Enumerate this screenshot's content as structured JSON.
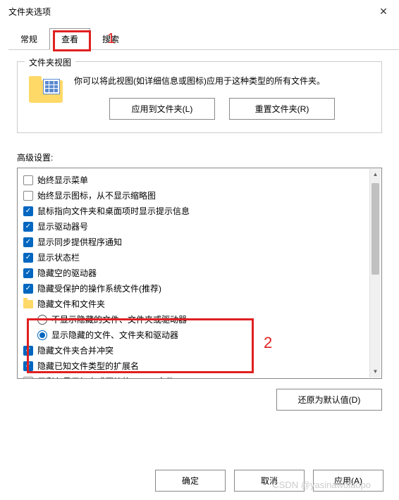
{
  "window": {
    "title": "文件夹选项"
  },
  "tabs": {
    "general": "常规",
    "view": "查看",
    "search": "搜索",
    "active": "view"
  },
  "folder_view": {
    "label": "文件夹视图",
    "text": "你可以将此视图(如详细信息或图标)应用于这种类型的所有文件夹。",
    "apply_button": "应用到文件夹(L)",
    "reset_button": "重置文件夹(R)"
  },
  "advanced": {
    "label": "高级设置:",
    "restore_defaults": "还原为默认值(D)",
    "items": [
      {
        "type": "checkbox",
        "checked": false,
        "label": "始终显示菜单"
      },
      {
        "type": "checkbox",
        "checked": false,
        "label": "始终显示图标，从不显示缩略图"
      },
      {
        "type": "checkbox",
        "checked": true,
        "label": "鼠标指向文件夹和桌面项时显示提示信息"
      },
      {
        "type": "checkbox",
        "checked": true,
        "label": "显示驱动器号"
      },
      {
        "type": "checkbox",
        "checked": true,
        "label": "显示同步提供程序通知"
      },
      {
        "type": "checkbox",
        "checked": true,
        "label": "显示状态栏"
      },
      {
        "type": "checkbox",
        "checked": true,
        "label": "隐藏空的驱动器"
      },
      {
        "type": "checkbox",
        "checked": true,
        "label": "隐藏受保护的操作系统文件(推荐)"
      },
      {
        "type": "group",
        "label": "隐藏文件和文件夹",
        "children": [
          {
            "type": "radio",
            "checked": false,
            "label": "不显示隐藏的文件、文件夹或驱动器"
          },
          {
            "type": "radio",
            "checked": true,
            "label": "显示隐藏的文件、文件夹和驱动器"
          }
        ]
      },
      {
        "type": "checkbox",
        "checked": true,
        "label": "隐藏文件夹合并冲突"
      },
      {
        "type": "checkbox",
        "checked": true,
        "label": "隐藏已知文件类型的扩展名"
      },
      {
        "type": "checkbox",
        "checked": false,
        "label": "用彩色显示加密或压缩的 NTFS 文件"
      }
    ]
  },
  "dialog_buttons": {
    "ok": "确定",
    "cancel": "取消",
    "apply": "应用(A)"
  },
  "annotations": {
    "one": "1",
    "two": "2"
  },
  "watermark": "CSDN @yasinawolaopo"
}
